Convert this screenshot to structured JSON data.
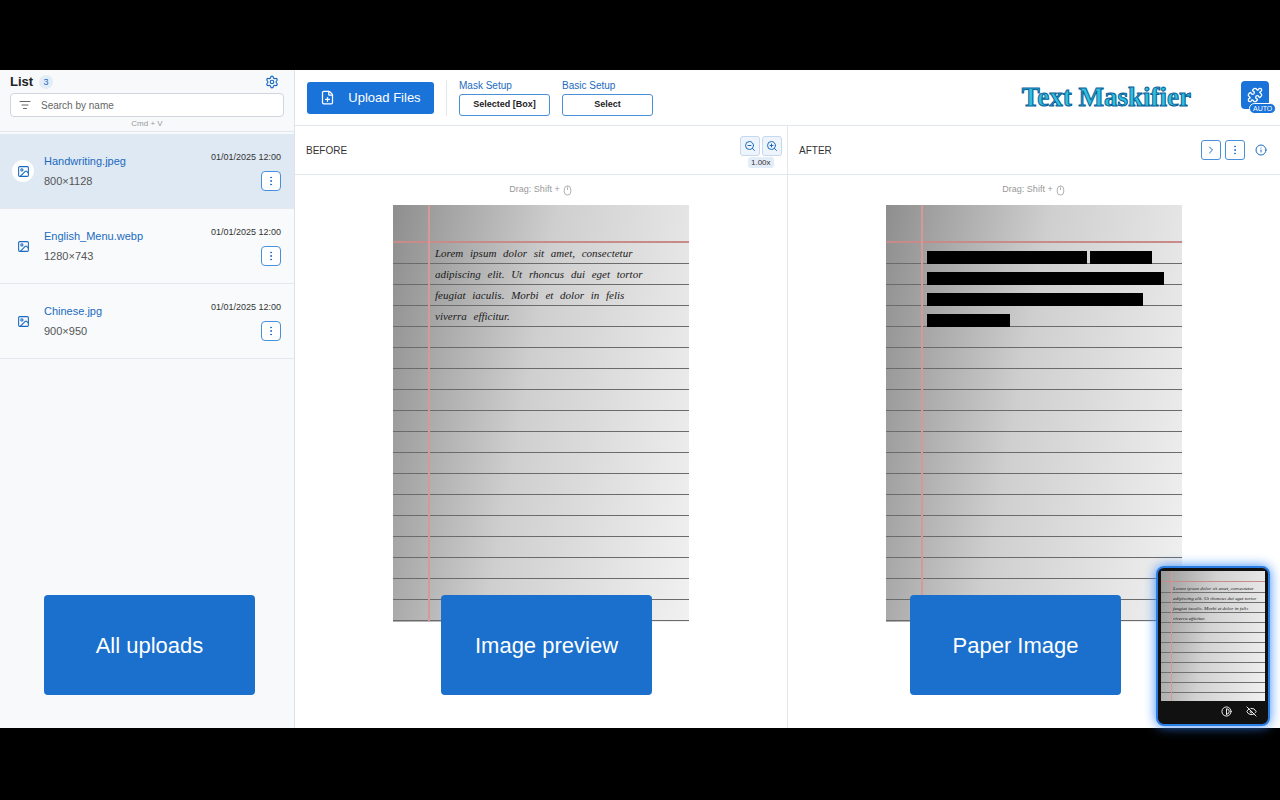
{
  "sidebar": {
    "title": "List",
    "count": "3",
    "search": {
      "placeholder": "Search by name"
    },
    "paste_hint": "Cmd + V",
    "items": [
      {
        "name": "Handwriting.jpeg",
        "size": "800×1128",
        "date": "01/01/2025 12:00",
        "selected": true
      },
      {
        "name": "English_Menu.webp",
        "size": "1280×743",
        "date": "01/01/2025 12:00",
        "selected": false
      },
      {
        "name": "Chinese.jpg",
        "size": "900×950",
        "date": "01/01/2025 12:00",
        "selected": false
      }
    ]
  },
  "toolbar": {
    "upload": "Upload Files",
    "mask_setup": {
      "label": "Mask Setup",
      "value": "Selected [Box]"
    },
    "basic_setup": {
      "label": "Basic Setup",
      "value": "Select"
    },
    "logo": "Text Maskifier",
    "plugin_badge": "AUTO"
  },
  "before": {
    "title": "BEFORE",
    "zoom": "1.00x",
    "drag_hint": "Drag: Shift +",
    "lines": [
      "Lorem ipsum dolor sit amet, consectetur",
      "adipiscing elit. Ut rhoncus dui eget tortor",
      "feugiat iaculis. Morbi et dolor in felis",
      "viverra efficitur."
    ]
  },
  "after": {
    "title": "AFTER",
    "drag_hint": "Drag: Shift +",
    "masks": [
      {
        "levels": [
          0.54,
          0.21
        ]
      },
      {
        "levels": [
          0.8
        ]
      },
      {
        "levels": [
          0.73
        ]
      },
      {
        "levels": [
          0.28
        ]
      }
    ]
  },
  "annotations": [
    "All uploads",
    "Image preview",
    "Paper Image"
  ]
}
